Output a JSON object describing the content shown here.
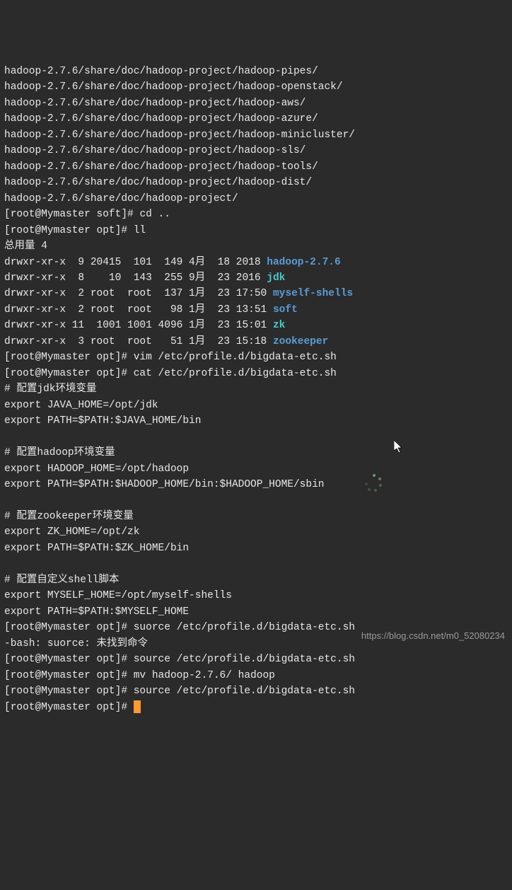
{
  "lines_top": [
    "hadoop-2.7.6/share/doc/hadoop-project/hadoop-pipes/",
    "hadoop-2.7.6/share/doc/hadoop-project/hadoop-openstack/",
    "hadoop-2.7.6/share/doc/hadoop-project/hadoop-aws/",
    "hadoop-2.7.6/share/doc/hadoop-project/hadoop-azure/",
    "hadoop-2.7.6/share/doc/hadoop-project/hadoop-minicluster/",
    "hadoop-2.7.6/share/doc/hadoop-project/hadoop-sls/",
    "hadoop-2.7.6/share/doc/hadoop-project/hadoop-tools/",
    "hadoop-2.7.6/share/doc/hadoop-project/hadoop-dist/",
    "hadoop-2.7.6/share/doc/hadoop-project/"
  ],
  "prompt_soft": "[root@Mymaster soft]# ",
  "prompt_opt": "[root@Mymaster opt]# ",
  "cmd_cd": "cd ..",
  "cmd_ll": "ll",
  "total": "总用量 4",
  "ls_rows": [
    {
      "pre": "drwxr-xr-x  9 20415  101  149 4月  18 2018 ",
      "name": "hadoop-2.7.6",
      "cls": "dir-blue"
    },
    {
      "pre": "drwxr-xr-x  8    10  143  255 9月  23 2016 ",
      "name": "jdk",
      "cls": "dir-cyan"
    },
    {
      "pre": "drwxr-xr-x  2 root  root  137 1月  23 17:50 ",
      "name": "myself-shells",
      "cls": "dir-blue"
    },
    {
      "pre": "drwxr-xr-x  2 root  root   98 1月  23 13:51 ",
      "name": "soft",
      "cls": "dir-blue"
    },
    {
      "pre": "drwxr-xr-x 11  1001 1001 4096 1月  23 15:01 ",
      "name": "zk",
      "cls": "dir-cyan"
    },
    {
      "pre": "drwxr-xr-x  3 root  root   51 1月  23 15:18 ",
      "name": "zookeeper",
      "cls": "dir-blue"
    }
  ],
  "cmd_vim": "vim /etc/profile.d/bigdata-etc.sh",
  "cmd_cat": "cat /etc/profile.d/bigdata-etc.sh",
  "file_content": [
    "# 配置jdk环境变量",
    "export JAVA_HOME=/opt/jdk",
    "export PATH=$PATH:$JAVA_HOME/bin",
    "",
    "# 配置hadoop环境变量",
    "export HADOOP_HOME=/opt/hadoop",
    "export PATH=$PATH:$HADOOP_HOME/bin:$HADOOP_HOME/sbin",
    "",
    "# 配置zookeeper环境变量",
    "export ZK_HOME=/opt/zk",
    "export PATH=$PATH:$ZK_HOME/bin",
    "",
    "# 配置自定义shell脚本",
    "export MYSELF_HOME=/opt/myself-shells",
    "export PATH=$PATH:$MYSELF_HOME"
  ],
  "cmd_suorce": "suorce /etc/profile.d/bigdata-etc.sh",
  "err_suorce": "-bash: suorce: 未找到命令",
  "cmd_source1": "source /etc/profile.d/bigdata-etc.sh",
  "cmd_mv": "mv hadoop-2.7.6/ hadoop",
  "cmd_source2": "source /etc/profile.d/bigdata-etc.sh",
  "watermark": "https://blog.csdn.net/m0_52080234"
}
